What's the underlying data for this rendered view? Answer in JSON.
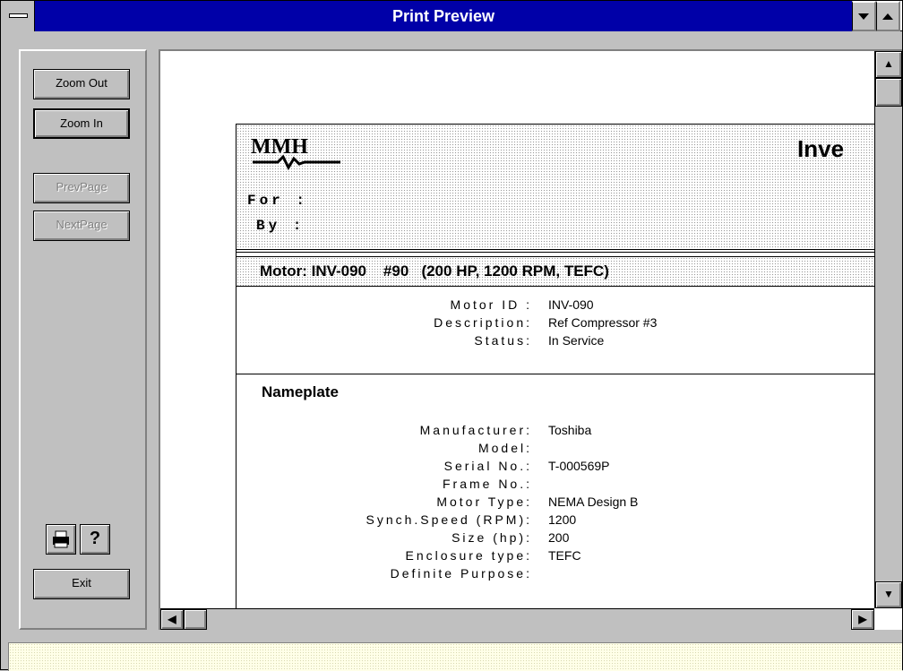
{
  "window": {
    "title": "Print Preview"
  },
  "controls": {
    "zoom_out": "Zoom Out",
    "zoom_in": "Zoom In",
    "prev_page": "PrevPage",
    "next_page": "NextPage",
    "exit": "Exit",
    "print_icon": "printer-icon",
    "help_icon": "question-icon"
  },
  "report": {
    "logo_text": "MMH",
    "title": "Inve",
    "for_label": "For :",
    "by_label": "By :",
    "motor_heading": "Motor: INV-090    #90   (200 HP, 1200 RPM, TEFC)",
    "motor_fields": [
      {
        "label": "Motor ID :",
        "value": "INV-090"
      },
      {
        "label": "Description:",
        "value": "Ref Compressor #3"
      },
      {
        "label": "Status:",
        "value": "In Service"
      }
    ],
    "nameplate_title": "Nameplate",
    "nameplate_fields": [
      {
        "label": "Manufacturer:",
        "value": "Toshiba"
      },
      {
        "label": "Model:",
        "value": ""
      },
      {
        "label": "Serial No.:",
        "value": "T-000569P"
      },
      {
        "label": "Frame No.:",
        "value": ""
      },
      {
        "label": "Motor Type:",
        "value": "NEMA Design B"
      },
      {
        "label": "Synch.Speed (RPM):",
        "value": "1200"
      },
      {
        "label": "Size (hp):",
        "value": "200"
      },
      {
        "label": "Enclosure type:",
        "value": "TEFC"
      },
      {
        "label": "Definite Purpose:",
        "value": ""
      }
    ]
  },
  "colors": {
    "titlebar": "#0000a8",
    "face": "#c0c0c0",
    "status": "#ffffe8"
  }
}
